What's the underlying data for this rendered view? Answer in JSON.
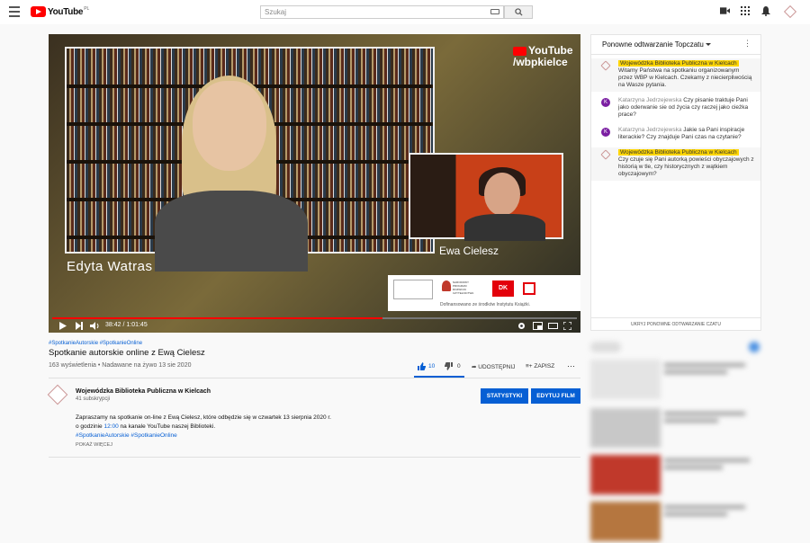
{
  "topbar": {
    "logo_text": "YouTube",
    "logo_country": "PL",
    "search_placeholder": "Szukaj"
  },
  "video": {
    "speaker1": "Edyta Watras",
    "speaker2": "Ewa Cielesz",
    "badge_line1": "YouTube",
    "badge_line2": "/wbpkielce",
    "sponsor_text": "Dofinansowano ze środków Instytutu Książki.",
    "sponsor2_lines": [
      "NARODOWY",
      "PROGRAM",
      "ROZWOJU",
      "CZYTELNICTWA"
    ],
    "sponsor3_text": "DK",
    "progress_fraction": 0.63,
    "time": "38:42 / 1:01:45"
  },
  "chat": {
    "title": "Ponowne odtwarzanie Topczatu",
    "footer": "UKRYJ PONOWNE ODTWARZANIE CZATU",
    "messages": [
      {
        "author": "Wojewódzka Biblioteka Publiczna w Kielcach",
        "text": "Witamy Państwa na spotkaniu organizowanym przez WBP w Kielcach. Czekamy z niecierpliwością na Wasze pytania.",
        "owner": true
      },
      {
        "author": "Katarzyna Jedrzejewska",
        "text": "Czy pisanie traktuje Pani jako oderwanie sie od życia czy raczej jako cieżka prace?",
        "owner": false,
        "initial": "K"
      },
      {
        "author": "Katarzyna Jedrzejewska",
        "text": "Jakie sa Pani inspiracje literackie? Czy znajduje Pani czas na czytanie?",
        "owner": false,
        "initial": "K"
      },
      {
        "author": "Wojewódzka Biblioteka Publiczna w Kielcach",
        "text": "Czy czuje się Pani autorką powieści obyczajowych z historią w tle, czy historycznych z wątkiem obyczajowym?",
        "owner": true
      }
    ]
  },
  "info": {
    "hashtags": "#SpotkanieAutorskie #SpotkanieOnline",
    "title": "Spotkanie autorskie online z Ewą Cielesz",
    "views": "163 wyświetlenia • Nadawane na żywo 13 sie 2020",
    "likes": "10",
    "dislikes": "0",
    "share": "UDOSTĘPNIJ",
    "save": "ZAPISZ"
  },
  "channel": {
    "name": "Wojewódzka Biblioteka Publiczna w Kielcach",
    "subs": "41 subskrypcji",
    "btn_stats": "STATYSTYKI",
    "btn_edit": "EDYTUJ FILM",
    "desc_line1": "Zapraszamy na spotkanie on-line z Ewą Cielesz, które odbędzie się w czwartek 13 sierpnia 2020 r.",
    "desc_line2_pre": "o godzinie ",
    "desc_line2_time": "12:00",
    "desc_line2_post": " na kanale YouTube naszej Biblioteki.",
    "desc_tags": "#SpotkanieAutorskie #SpotkanieOnline",
    "show_more": "POKAŻ WIĘCEJ"
  },
  "colors": {
    "accent": "#065fd4",
    "brand": "#ff0000",
    "owner_highlight": "#ffd600"
  }
}
